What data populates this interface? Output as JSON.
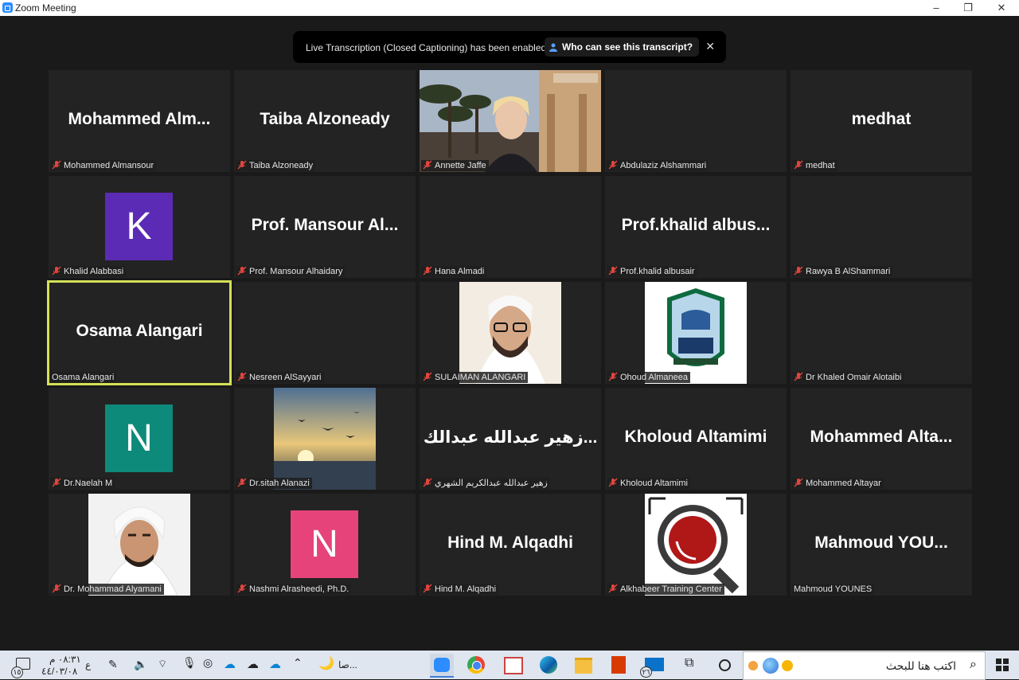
{
  "window": {
    "title": "Zoom Meeting",
    "minimize": "–",
    "restore": "❐",
    "close": "✕"
  },
  "banner": {
    "message": "Live Transcription (Closed Captioning) has been enabled",
    "button": "Who can see this transcript?",
    "close": "✕"
  },
  "tiles": [
    {
      "big": "Mohammed  Alm...",
      "label": "Mohammed Almansour",
      "muted": true
    },
    {
      "big": "Taiba Alzoneady",
      "label": "Taiba Alzoneady",
      "muted": true
    },
    {
      "big": "",
      "label": "Annette Jaffe",
      "muted": true,
      "photo": "woman-headset-campus"
    },
    {
      "big": "",
      "label": "Abdulaziz Alshammari",
      "muted": true
    },
    {
      "big": "medhat",
      "label": "medhat",
      "muted": true
    },
    {
      "big": "",
      "label": "Khalid Alabbasi",
      "muted": true,
      "avatar": "K",
      "avatar_color": "#5b2bb5"
    },
    {
      "big": "Prof.  Mansour  Al...",
      "label": "Prof. Mansour Alhaidary",
      "muted": true
    },
    {
      "big": "",
      "label": "Hana Almadi",
      "muted": true
    },
    {
      "big": "Prof.khalid  albus...",
      "label": "Prof.khalid albusair",
      "muted": true
    },
    {
      "big": "",
      "label": "Rawya B AlShammari",
      "muted": true
    },
    {
      "big": "Osama Alangari",
      "label": "Osama Alangari",
      "muted": false,
      "active": true
    },
    {
      "big": "",
      "label": "Nesreen AlSayyari",
      "muted": true
    },
    {
      "big": "",
      "label": "SULAIMAN ALANGARI",
      "muted": true,
      "photo": "man-glasses-ghutra"
    },
    {
      "big": "",
      "label": "Ohoud Almaneea",
      "muted": true,
      "photo": "university-logo"
    },
    {
      "big": "",
      "label": "Dr Khaled Omair Alotaibi",
      "muted": true
    },
    {
      "big": "",
      "label": "Dr.Naelah M",
      "muted": true,
      "avatar": "N",
      "avatar_color": "#0e8a7a"
    },
    {
      "big": "",
      "label": "Dr.sitah Alanazi",
      "muted": true,
      "photo": "sunset-birds"
    },
    {
      "big": "زهير عبدالله عبدالك...",
      "label": "زهير عبدالله عبدالكريم الشهري",
      "muted": true
    },
    {
      "big": "Kholoud Altamimi",
      "label": "Kholoud Altamimi",
      "muted": true
    },
    {
      "big": "Mohammed  Alta...",
      "label": "Mohammed Altayar",
      "muted": true
    },
    {
      "big": "",
      "label": "Dr. Mohammad Alyamani",
      "muted": true,
      "photo": "man-white-ghutra"
    },
    {
      "big": "",
      "label": "Nashmi Alrasheedi, Ph.D.",
      "muted": true,
      "avatar": "N",
      "avatar_color": "#e5437a"
    },
    {
      "big": "Hind M. Alqadhi",
      "label": "Hind M. Alqadhi",
      "muted": true
    },
    {
      "big": "",
      "label": "Alkhabeer Training Center",
      "muted": true,
      "photo": "magnifier-logo"
    },
    {
      "big": "Mahmoud  YOU...",
      "label": "Mahmoud YOUNES",
      "muted": false
    }
  ],
  "taskbar": {
    "time": "٠٨:٣١ م",
    "date": "٤٤/٠٣/٠٨",
    "lang": "ع",
    "weather": "صا...",
    "search_placeholder": "اكتب هنا للبحث",
    "notif_count": "١٥",
    "mail_badge": "٢٦"
  },
  "colors": {
    "active_border": "#d4e157",
    "muted_icon": "#e0463e",
    "banner_bg": "#000000"
  }
}
